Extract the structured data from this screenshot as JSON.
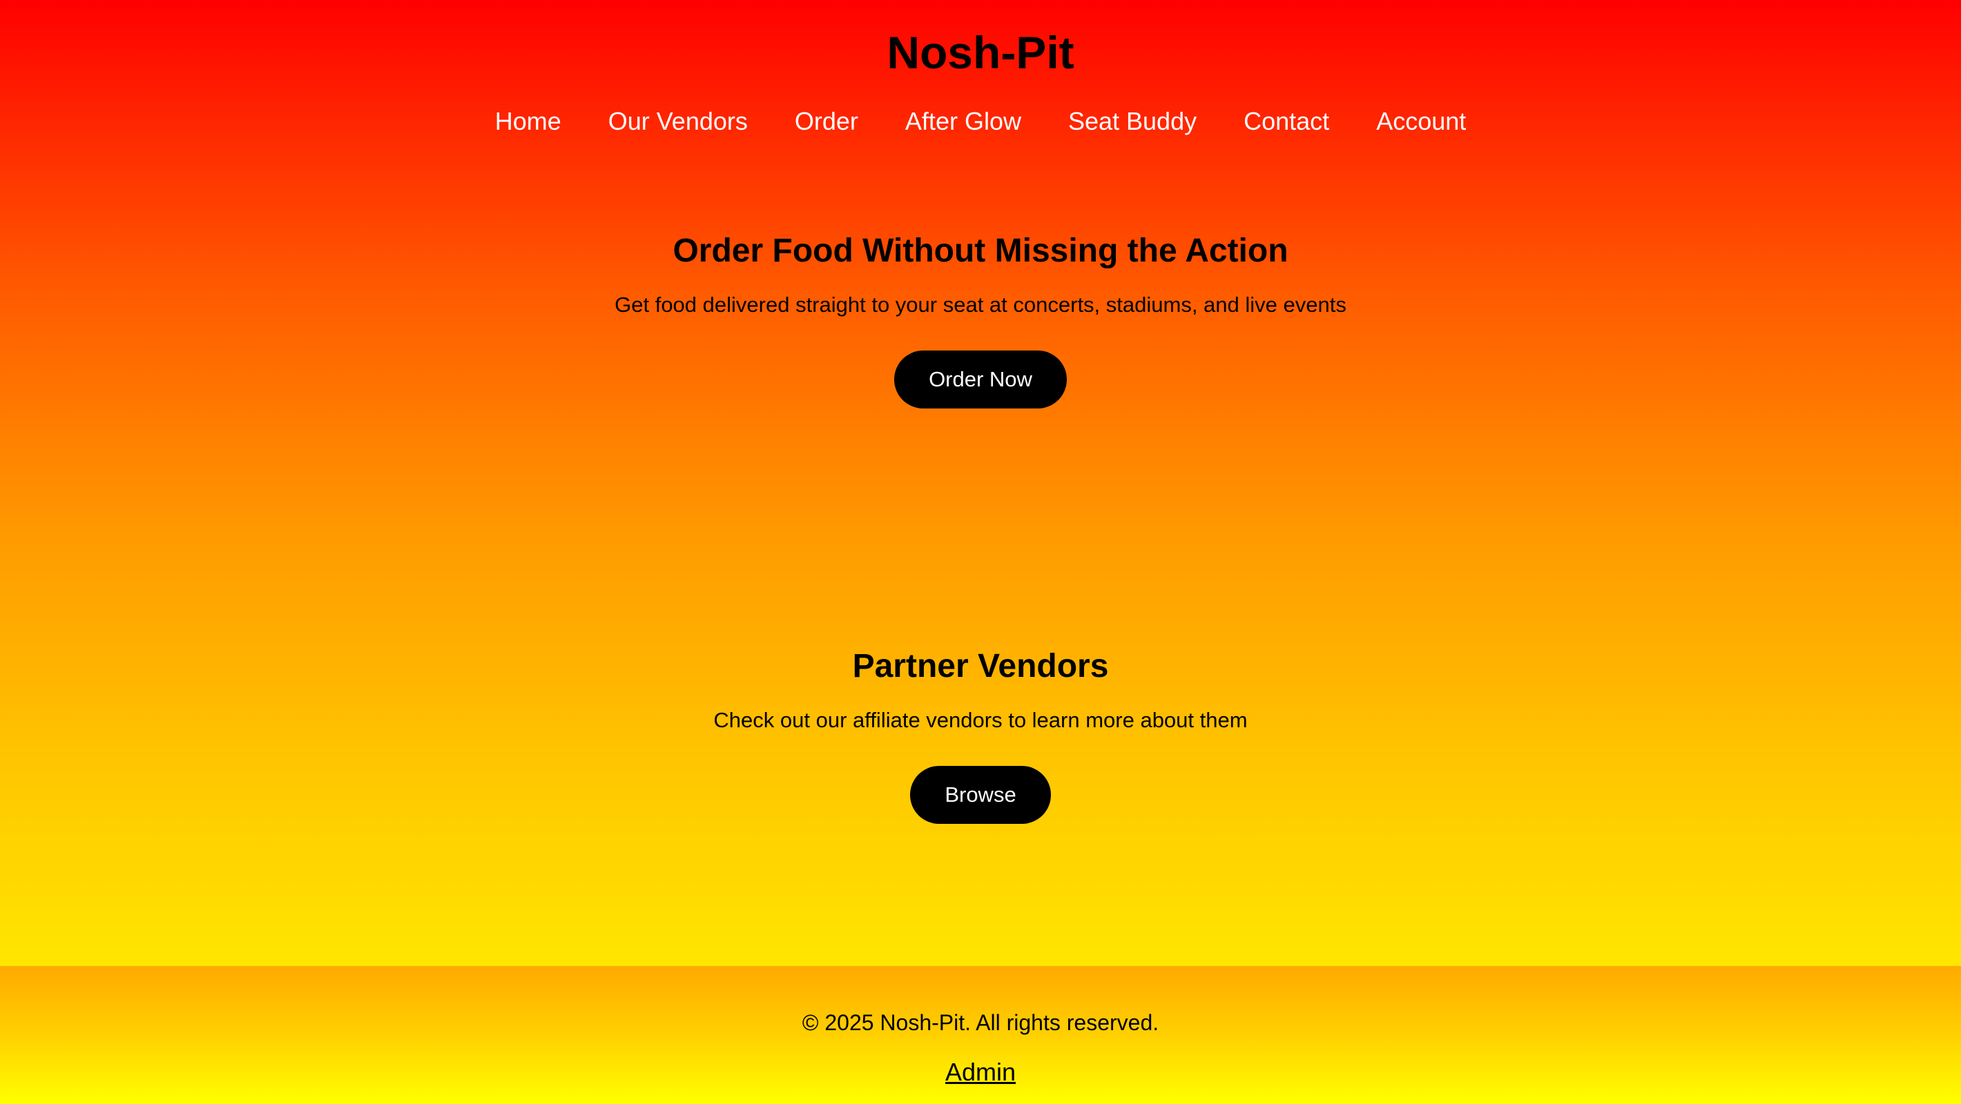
{
  "site": {
    "title": "Nosh-Pit"
  },
  "nav": {
    "items": [
      {
        "label": "Home"
      },
      {
        "label": "Our Vendors"
      },
      {
        "label": "Order"
      },
      {
        "label": "After Glow"
      },
      {
        "label": "Seat Buddy"
      },
      {
        "label": "Contact"
      },
      {
        "label": "Account"
      }
    ]
  },
  "hero": {
    "heading": "Order Food Without Missing the Action",
    "subtext": "Get food delivered straight to your seat at concerts, stadiums, and live events",
    "button_label": "Order Now"
  },
  "vendors": {
    "heading": "Partner Vendors",
    "subtext": "Check out our affiliate vendors to learn more about them",
    "button_label": "Browse"
  },
  "footer": {
    "copyright": "© 2025 Nosh-Pit. All rights reserved.",
    "admin_link": "Admin"
  },
  "colors": {
    "gradient_top": "#ff0000",
    "gradient_bottom": "#ffe600",
    "button_bg": "#000000",
    "nav_text": "#ffffff"
  }
}
